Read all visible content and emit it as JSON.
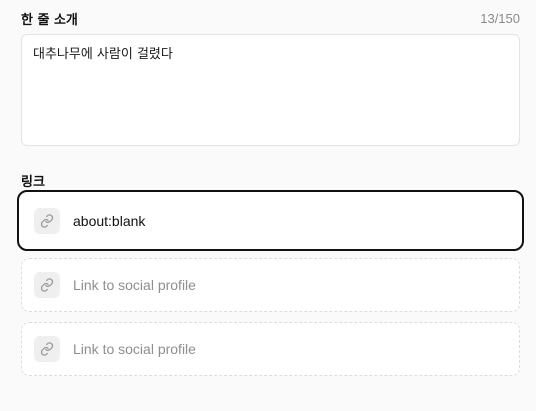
{
  "bio": {
    "label": "한 줄 소개",
    "counter": "13/150",
    "value": "대추나무에 사람이 걸렸다"
  },
  "links": {
    "label": "링크",
    "items": [
      {
        "value": "about:blank",
        "placeholder": "Link to social profile",
        "icon": "link-icon"
      },
      {
        "value": "",
        "placeholder": "Link to social profile",
        "icon": "link-icon"
      },
      {
        "value": "",
        "placeholder": "Link to social profile",
        "icon": "link-icon"
      }
    ]
  },
  "colors": {
    "background": "#fafafa",
    "active_border": "#111111",
    "placeholder_text": "#8e8e8e",
    "icon_bg": "#efefef"
  }
}
